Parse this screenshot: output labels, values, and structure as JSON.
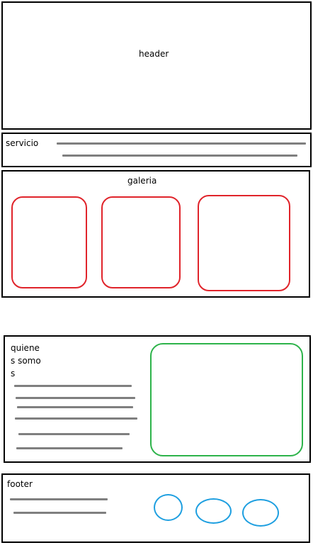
{
  "header": {
    "label": "header"
  },
  "servicio": {
    "label": "servicio"
  },
  "galeria": {
    "label": "galeria",
    "frame_count": 3
  },
  "quienes_somos": {
    "label_line1": "quiene",
    "label_line2": "s somo",
    "label_line3": "s"
  },
  "footer": {
    "label": "footer",
    "icon_count": 3
  },
  "colors": {
    "outline": "#000000",
    "text_lines": "#7f7f7f",
    "gallery_frames": "#e0242b",
    "about_image": "#2db34a",
    "footer_circles": "#1e9fe0"
  }
}
